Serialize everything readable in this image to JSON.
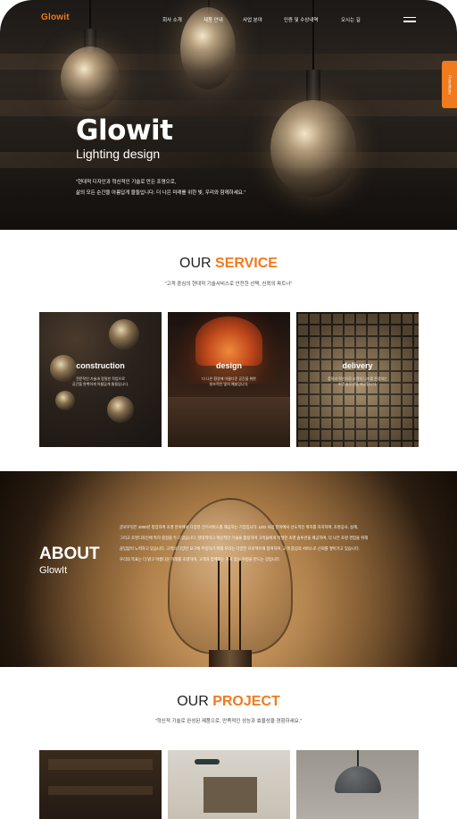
{
  "colors": {
    "accent": "#f07a1e",
    "text_dark": "#222222",
    "white": "#ffffff"
  },
  "header": {
    "logo": "Glowit",
    "nav": [
      "회사 소개",
      "제품 안내",
      "사업 분야",
      "인증 및 수상내역",
      "오시는 길"
    ],
    "menu_icon": "hamburger-menu-icon",
    "side_tab": "Potentiaire"
  },
  "hero": {
    "title": "Glowit",
    "subtitle": "Lighting design",
    "desc_line1": "\"현대적 디자인과 혁신적인 기술로 만든 조명으로,",
    "desc_line2": "삶의 모든 순간을 아름답게 물들입니다. 더 나은 미래를 위한 빛, 우리와 함께하세요.\""
  },
  "service": {
    "title_prefix": "OUR ",
    "title_accent": "SERVICE",
    "subtitle": "\"고객 중심의 현대적 기술서비스로 안전한 선택, 신뢰의 파트너\"",
    "cards": [
      {
        "label": "construction",
        "desc_line1": "전문적인 기술과 정밀한 작업으로",
        "desc_line2": "공간을 완벽하게 아름답게 물들입니다."
      },
      {
        "label": "design",
        "desc_line1": "더 나은 환경에 아름다운 공간을 위한",
        "desc_line2": "창조적인 빛의 예술입니다."
      },
      {
        "label": "delivery",
        "desc_line1": "품질과 혁신으로 고객의 니즈를 존중하는",
        "desc_line2": "조명 솔루션을 제공합니다."
      }
    ]
  },
  "about": {
    "title": "ABOUT",
    "subtitle": "GlowIt",
    "lines": [
      "글로우잇은 2000년 창업하여 조명 분야에서 다양한 전기서비스를 제공하는 기업입니다. LED 사업 분야에서 선도적인 위치를 차지하며, 조명공사, 설계,",
      "그리고 조명디자인에 특히 중점을 두고 있습니다. 현대적이고 혁신적인 기술을 활용하여 고객들에게 적절한 조명 솔루션을 제공하며, 더 나은 조명 경험을 위해",
      "끊임없이 노력하고 있습니다. 고객의 다양한 요구에 부응하기 위해 우리는 다양한 프로젝트에 참여하며, 고객 중심의 서비스로 신뢰를 쌓아가고 있습니다.",
      "우리의 목표는 더 밝고 아름다운 미래를 조명하며, 고객과 함께하는 가치 있는 여정을 만드는 것입니다."
    ]
  },
  "project": {
    "title_prefix": "OUR ",
    "title_accent": "PROJECT",
    "subtitle": "\"혁신적 기술로 완성된 제품으로, 만족적인 성능과 효율성을 경험하세요.\""
  }
}
